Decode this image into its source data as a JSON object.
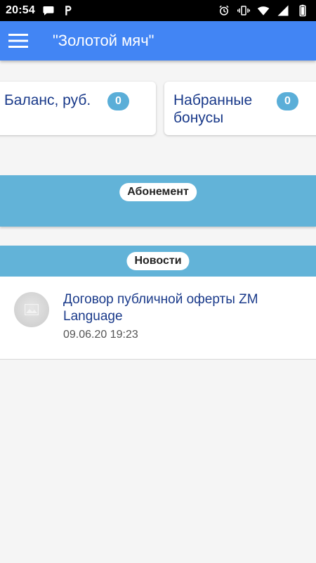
{
  "status_bar": {
    "time": "20:54",
    "left_icons": [
      "chat-bubble-icon",
      "parking-p-icon"
    ],
    "right_icons": [
      "alarm-clock-icon",
      "vibrate-icon",
      "wifi-icon",
      "signal-icon",
      "battery-icon"
    ]
  },
  "app_bar": {
    "menu_icon": "hamburger-menu-icon",
    "title": "\"Золотой мяч\"",
    "color": "#4285f4"
  },
  "cards": {
    "balance": {
      "label": "Баланс, руб.",
      "value": "0"
    },
    "bonuses": {
      "label_line1": "Набранные",
      "label_line2": "бонусы",
      "value": "0"
    }
  },
  "sections": {
    "subscription": {
      "label": "Абонемент"
    },
    "news": {
      "label": "Новости"
    },
    "band_color": "#62b3d8"
  },
  "news_items": [
    {
      "thumb_icon": "image-placeholder-icon",
      "title": "Договор публичной оферты ZM Language",
      "date": "09.06.20 19:23"
    }
  ]
}
